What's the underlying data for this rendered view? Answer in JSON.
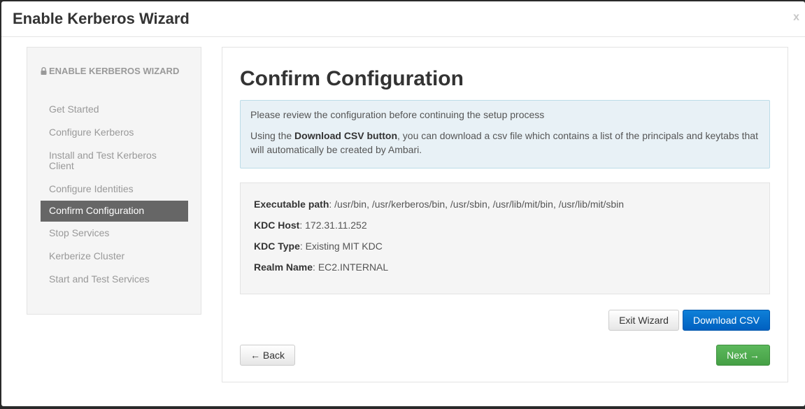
{
  "modal": {
    "title": "Enable Kerberos Wizard",
    "close_label": "x"
  },
  "sidebar": {
    "header": "ENABLE KERBEROS WIZARD",
    "items": [
      {
        "label": "Get Started",
        "active": false
      },
      {
        "label": "Configure Kerberos",
        "active": false
      },
      {
        "label": "Install and Test Kerberos Client",
        "active": false
      },
      {
        "label": "Configure Identities",
        "active": false
      },
      {
        "label": "Confirm Configuration",
        "active": true
      },
      {
        "label": "Stop Services",
        "active": false
      },
      {
        "label": "Kerberize Cluster",
        "active": false
      },
      {
        "label": "Start and Test Services",
        "active": false
      }
    ]
  },
  "main": {
    "title": "Confirm Configuration",
    "alert": {
      "line1": "Please review the configuration before continuing the setup process",
      "line2_prefix": "Using the ",
      "line2_bold": "Download CSV button",
      "line2_suffix": ", you can download a csv file which contains a list of the principals and keytabs that will automatically be created by Ambari."
    },
    "details": [
      {
        "label": "Executable path",
        "value": ": /usr/bin, /usr/kerberos/bin, /usr/sbin, /usr/lib/mit/bin, /usr/lib/mit/sbin"
      },
      {
        "label": "KDC Host",
        "value": ": 172.31.11.252"
      },
      {
        "label": "KDC Type",
        "value": ": Existing MIT KDC"
      },
      {
        "label": "Realm Name",
        "value": ": EC2.INTERNAL"
      }
    ],
    "buttons": {
      "exit": "Exit Wizard",
      "download": "Download CSV",
      "back": "← Back",
      "next": "Next →"
    }
  },
  "colors": {
    "active_nav_bg": "#666666",
    "primary": "#0066cc",
    "success": "#4cae4c",
    "alert_bg": "#e8f1f6"
  }
}
